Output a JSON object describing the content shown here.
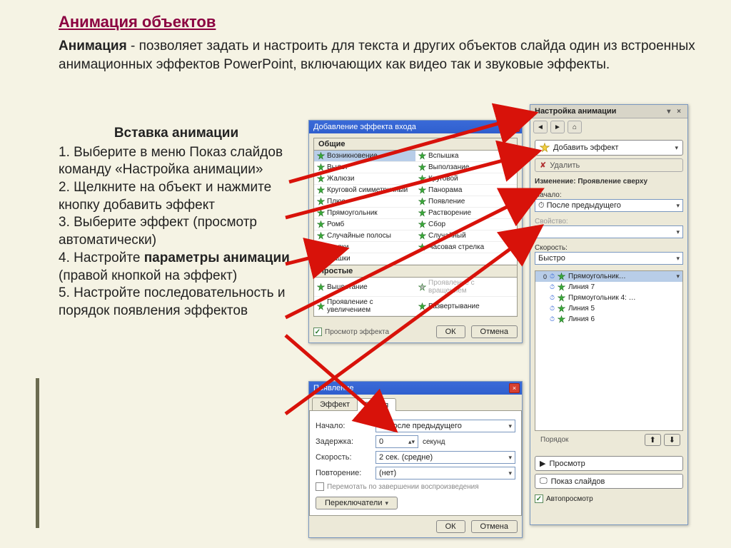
{
  "title": "Анимация объектов",
  "intro_bold": "Анимация",
  "intro_rest": " - позволяет задать и настроить для текста и других объектов слайда один из встроенных анимационных эффектов PowerPoint, включающих как видео так и звуковые эффекты.",
  "left": {
    "heading": "Вставка анимации",
    "s1": "1. Выберите в меню Показ слайдов команду «Настройка анимации»",
    "s2": "2. Щелкните на объект и нажмите кнопку добавить эффект",
    "s3": "3. Выберите эффект (просмотр автоматически)",
    "s4a": "4. Настройте ",
    "s4b": "параметры анимации",
    "s4c": " (правой кнопкой на эффект)",
    "s5": "5. Настройте последовательность и порядок появления эффектов"
  },
  "dlg_add": {
    "title": "Добавление эффекта входа",
    "group1": "Общие",
    "group2": "Простые",
    "effects1": [
      "Возникновение",
      "Вспышка",
      "Вылет",
      "Выползание",
      "Жалюзи",
      "Круговой",
      "Круговой симметричный",
      "Панорама",
      "Плюс",
      "Появление",
      "Прямоугольник",
      "Растворение",
      "Ромб",
      "Сбор",
      "Случайные полосы",
      "Случайный",
      "Уголки",
      "Часовая стрелка",
      "Шашки",
      ""
    ],
    "effects2": [
      "Выцветание",
      "Проявление с вращением",
      "Проявление с увеличением",
      "Развертывание"
    ],
    "preview": "Просмотр эффекта",
    "ok": "ОК",
    "cancel": "Отмена"
  },
  "dlg_time": {
    "title": "Появление",
    "tab_effect": "Эффект",
    "tab_time": "Время",
    "start": "Начало:",
    "start_val": "После предыдущего",
    "delay": "Задержка:",
    "delay_val": "0",
    "delay_unit": "секунд",
    "speed": "Скорость:",
    "speed_val": "2 сек. (средне)",
    "repeat": "Повторение:",
    "repeat_val": "(нет)",
    "rewind": "Перемотать по завершении воспроизведения",
    "switches": "Переключатели",
    "ok": "ОК",
    "cancel": "Отмена"
  },
  "pane": {
    "title": "Настройка анимации",
    "add": "Добавить эффект",
    "del": "Удалить",
    "change_hdr": "Изменение: Проявление сверху",
    "start": "Начало:",
    "start_val": "После предыдущего",
    "prop": "Свойство:",
    "speed": "Скорость:",
    "speed_val": "Быстро",
    "items": [
      "Прямоугольник…",
      "Линия 7",
      "Прямоугольник 4: …",
      "Линия 5",
      "Линия 6"
    ],
    "order_lbl": "Порядок",
    "play": "Просмотр",
    "slideshow": "Показ слайдов",
    "autoprev": "Автопросмотр"
  }
}
